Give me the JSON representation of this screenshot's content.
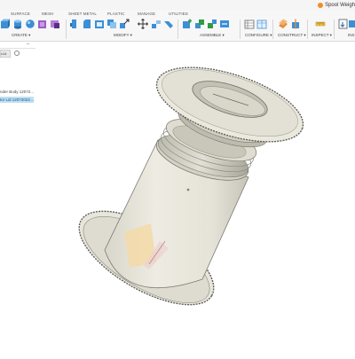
{
  "window": {
    "document_title": "Spool Weigh"
  },
  "ribbon": {
    "tabs": [
      "SURFACE",
      "MESH",
      "SHEET METAL",
      "PLASTIC",
      "MANAGE",
      "UTILITIES"
    ],
    "groups": [
      "CREATE ▾",
      "MODIFY ▾",
      "ASSEMBLE ▾",
      "CONFIGURE ▾",
      "CONSTRUCT ▾",
      "INSPECT ▾",
      "INS"
    ]
  },
  "browser": {
    "collapse_label": "–",
    "document_chip": "v14",
    "rows": [
      {
        "label": "nder Body 12072...",
        "selected": false
      },
      {
        "label": "tor Lid 12072023 ...",
        "selected": true
      }
    ]
  },
  "colors": {
    "accent": "#2b7bbf",
    "selection": "#bfe0f4",
    "model_body": "#e9e7dc",
    "model_shadow": "#cfcdbf",
    "model_outline": "#6f6f6a",
    "selected_face": "#f5d9a8"
  },
  "icons": [
    "box-icon",
    "sphere-icon",
    "create-form-icon",
    "derive-icon",
    "press-pull-icon",
    "fillet-icon",
    "shell-icon",
    "combine-icon",
    "move-icon",
    "align-icon",
    "new-component-icon",
    "joint-icon",
    "as-built-joint-icon",
    "parameters-icon",
    "table-icon",
    "offset-plane-icon",
    "axis-icon",
    "measure-icon",
    "insert-icon"
  ]
}
